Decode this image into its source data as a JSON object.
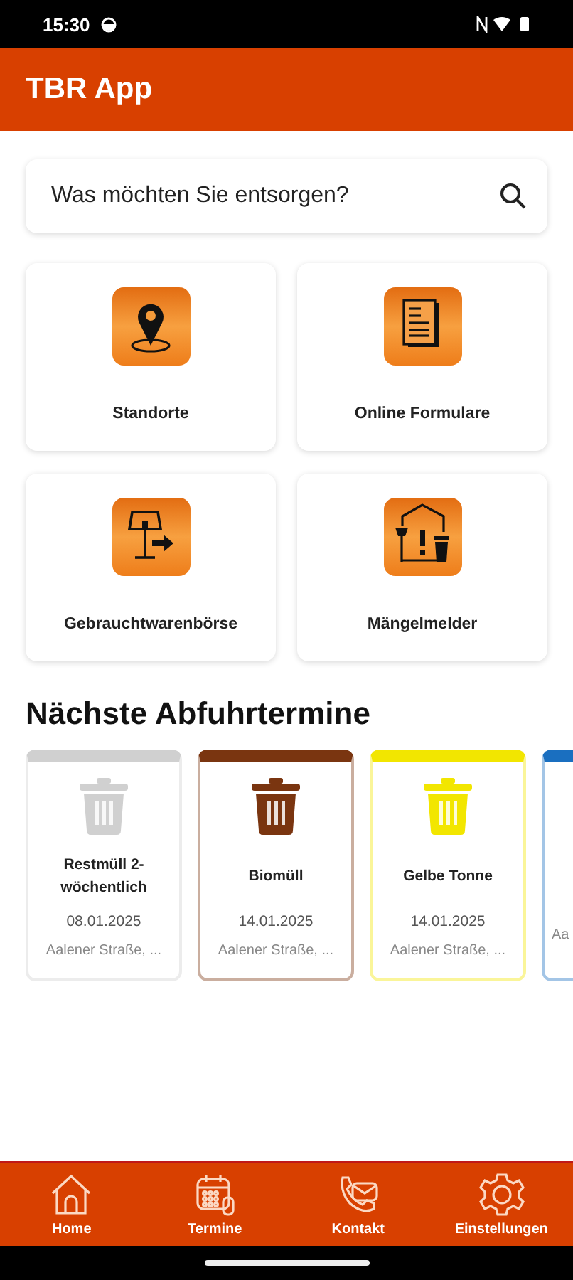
{
  "status_bar": {
    "time": "15:30"
  },
  "app_bar": {
    "title": "TBR App"
  },
  "search": {
    "placeholder": "Was möchten Sie entsorgen?"
  },
  "tiles": [
    {
      "label": "Standorte",
      "kind": "location"
    },
    {
      "label": "Online Formulare",
      "kind": "forms"
    },
    {
      "label": "Gebrauchtwarenbörse",
      "kind": "exchange"
    },
    {
      "label": "Mängelmelder",
      "kind": "report"
    }
  ],
  "section_title": "Nächste Abfuhrtermine",
  "pickups": [
    {
      "title": "Restmüll 2-wöchentlich",
      "date": "08.01.2025",
      "address": "Aalener Straße, ...",
      "color": "#d0d0d0"
    },
    {
      "title": "Biomüll",
      "date": "14.01.2025",
      "address": "Aalener Straße, ...",
      "color": "#7a3510"
    },
    {
      "title": "Gelbe Tonne",
      "date": "14.01.2025",
      "address": "Aalener Straße, ...",
      "color": "#f2e600"
    },
    {
      "address": "Aa",
      "color": "#1a6fc0"
    }
  ],
  "nav": [
    {
      "label": "Home",
      "kind": "home"
    },
    {
      "label": "Termine",
      "kind": "calendar"
    },
    {
      "label": "Kontakt",
      "kind": "contact"
    },
    {
      "label": "Einstellungen",
      "kind": "settings"
    }
  ]
}
